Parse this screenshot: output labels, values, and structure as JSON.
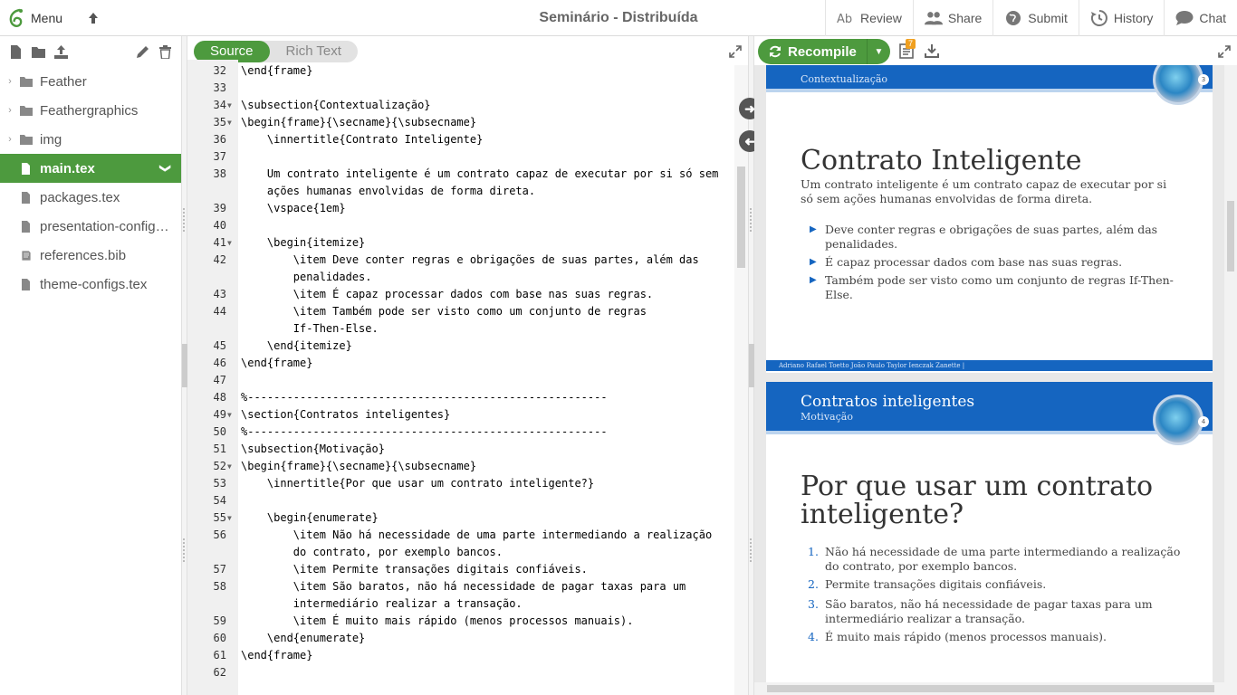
{
  "topbar": {
    "menu_label": "Menu",
    "project_title": "Seminário - Distribuída",
    "review_label": "Review",
    "share_label": "Share",
    "submit_label": "Submit",
    "history_label": "History",
    "chat_label": "Chat"
  },
  "file_tree": {
    "items": [
      {
        "name": "Feather",
        "type": "folder"
      },
      {
        "name": "Feathergraphics",
        "type": "folder"
      },
      {
        "name": "img",
        "type": "folder"
      },
      {
        "name": "main.tex",
        "type": "file",
        "selected": true
      },
      {
        "name": "packages.tex",
        "type": "file"
      },
      {
        "name": "presentation-configs.tex",
        "type": "file"
      },
      {
        "name": "references.bib",
        "type": "bib"
      },
      {
        "name": "theme-configs.tex",
        "type": "file"
      }
    ]
  },
  "editor": {
    "mode_source": "Source",
    "mode_rich": "Rich Text",
    "lines": [
      {
        "n": "32",
        "code": "\\end{frame}"
      },
      {
        "n": "33",
        "code": ""
      },
      {
        "n": "34",
        "code": "\\subsection{Contextualização}"
      },
      {
        "n": "35",
        "code": "\\begin{frame}{\\secname}{\\subsecname}"
      },
      {
        "n": "36",
        "code": "    \\innertitle{Contrato Inteligente}"
      },
      {
        "n": "37",
        "code": ""
      },
      {
        "n": "38",
        "code": "    Um contrato inteligente é um contrato capaz de executar por si só sem"
      },
      {
        "n": "",
        "code": "    ações humanas envolvidas de forma direta."
      },
      {
        "n": "39",
        "code": "    \\vspace{1em}"
      },
      {
        "n": "40",
        "code": ""
      },
      {
        "n": "41",
        "code": "    \\begin{itemize}"
      },
      {
        "n": "42",
        "code": "        \\item Deve conter regras e obrigações de suas partes, além das"
      },
      {
        "n": "",
        "code": "        penalidades."
      },
      {
        "n": "43",
        "code": "        \\item É capaz processar dados com base nas suas regras."
      },
      {
        "n": "44",
        "code": "        \\item Também pode ser visto como um conjunto de regras"
      },
      {
        "n": "",
        "code": "        If-Then-Else."
      },
      {
        "n": "45",
        "code": "    \\end{itemize}"
      },
      {
        "n": "46",
        "code": "\\end{frame}"
      },
      {
        "n": "47",
        "code": ""
      },
      {
        "n": "48",
        "code": "%-------------------------------------------------------"
      },
      {
        "n": "49",
        "code": "\\section{Contratos inteligentes}"
      },
      {
        "n": "50",
        "code": "%-------------------------------------------------------"
      },
      {
        "n": "51",
        "code": "\\subsection{Motivação}"
      },
      {
        "n": "52",
        "code": "\\begin{frame}{\\secname}{\\subsecname}"
      },
      {
        "n": "53",
        "code": "    \\innertitle{Por que usar um contrato inteligente?}"
      },
      {
        "n": "54",
        "code": ""
      },
      {
        "n": "55",
        "code": "    \\begin{enumerate}"
      },
      {
        "n": "56",
        "code": "        \\item Não há necessidade de uma parte intermediando a realização"
      },
      {
        "n": "",
        "code": "        do contrato, por exemplo bancos."
      },
      {
        "n": "57",
        "code": "        \\item Permite transações digitais confiáveis."
      },
      {
        "n": "58",
        "code": "        \\item São baratos, não há necessidade de pagar taxas para um"
      },
      {
        "n": "",
        "code": "        intermediário realizar a transação."
      },
      {
        "n": "59",
        "code": "        \\item É muito mais rápido (menos processos manuais)."
      },
      {
        "n": "60",
        "code": "    \\end{enumerate}"
      },
      {
        "n": "61",
        "code": "\\end{frame}"
      },
      {
        "n": "62",
        "code": ""
      }
    ]
  },
  "pdf": {
    "recompile_label": "Recompile",
    "logs_badge": "7",
    "slide3": {
      "subtitle": "Contextualização",
      "page_num": "3",
      "title": "Contrato Inteligente",
      "intro": "Um contrato inteligente é um contrato capaz de executar por si só sem ações humanas envolvidas de forma direta.",
      "items": [
        "Deve conter regras e obrigações de suas partes, além das penalidades.",
        "É capaz processar dados com base nas suas regras.",
        "Também pode ser visto como um conjunto de regras If-Then-Else."
      ],
      "footer": "Adriano Rafael Toetto  João Paulo Taylor Ienczak Zanette |"
    },
    "slide4": {
      "head_title": "Contratos inteligentes",
      "subtitle": "Motivação",
      "page_num": "4",
      "title": "Por que usar um contrato inteligente?",
      "items": [
        "Não há necessidade de uma parte intermediando a realização do contrato, por exemplo bancos.",
        "Permite transações digitais confiáveis.",
        "São baratos, não há necessidade de pagar taxas para um intermediário realizar a transação.",
        "É muito mais rápido (menos processos manuais)."
      ]
    }
  },
  "colors": {
    "accent_green": "#4d9a3e",
    "slide_blue": "#1565c0",
    "badge_orange": "#f0a020"
  }
}
